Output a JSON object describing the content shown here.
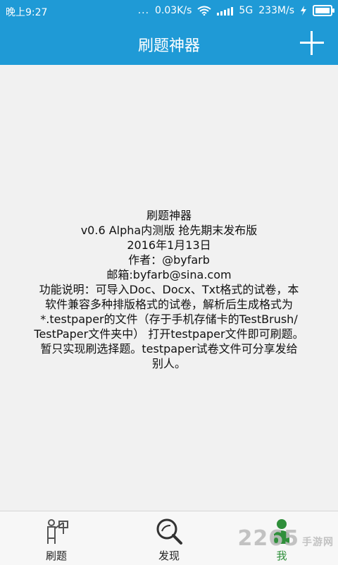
{
  "status_bar": {
    "time": "晚上9:27",
    "dots": "...",
    "network_speed": "0.03K/s",
    "network_type": "5G",
    "data_speed": "233M/s",
    "icons": [
      "wifi-icon",
      "signal-icon",
      "charging-icon",
      "battery-icon"
    ]
  },
  "app_bar": {
    "title": "刷题神器",
    "add_icon": "plus-icon"
  },
  "about": {
    "lines": [
      "刷题神器",
      "v0.6 Alpha内测版 抢先期末发布版",
      "2016年1月13日",
      "作者：@byfarb",
      "邮箱:byfarb@sina.com",
      "功能说明：可导入Doc、Docx、Txt格式的试卷，本",
      "软件兼容多种排版格式的试卷，解析后生成格式为",
      "*.testpaper的文件（存于手机存储卡的TestBrush/",
      "TestPaper文件夹中） 打开testpaper文件即可刷题。",
      "暂只实现刷选择题。testpaper试卷文件可分享发给",
      "别人。"
    ]
  },
  "tabs": [
    {
      "label": "刷题",
      "icon": "practice-icon",
      "active": false
    },
    {
      "label": "发现",
      "icon": "discover-icon",
      "active": false
    },
    {
      "label": "我",
      "icon": "profile-icon",
      "active": true
    }
  ],
  "watermark": {
    "number": "2265",
    "text": "手游网"
  },
  "colors": {
    "primary": "#1f9ad6",
    "background": "#f1f1f1",
    "active_tab": "#2f8f3b"
  }
}
